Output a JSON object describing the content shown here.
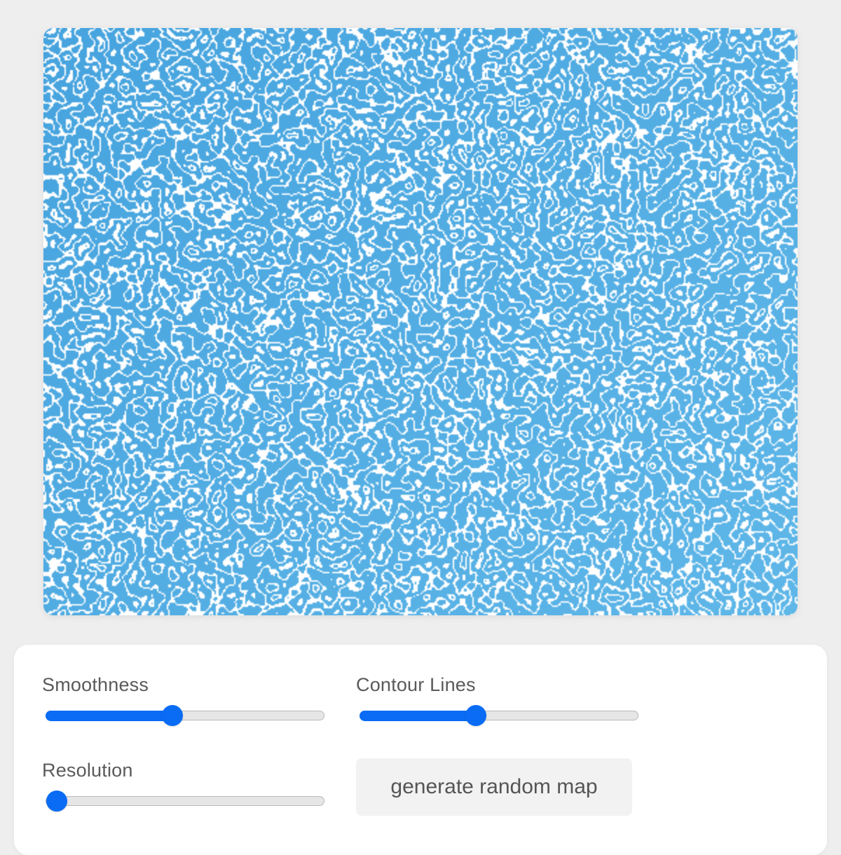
{
  "map": {
    "colors": {
      "fill": "#4aa6e0",
      "fill_light": "#62b6e6",
      "background": "#ffffff"
    }
  },
  "controls": {
    "smoothness": {
      "label": "Smoothness",
      "value": 0.45
    },
    "contour_lines": {
      "label": "Contour Lines",
      "value": 0.41
    },
    "resolution": {
      "label": "Resolution",
      "value": 0.0
    },
    "generate_button": {
      "label": "generate random map"
    }
  },
  "colors": {
    "accent": "#0a6cf5",
    "track": "#e6e6e6",
    "page_background": "#eeeeee"
  }
}
